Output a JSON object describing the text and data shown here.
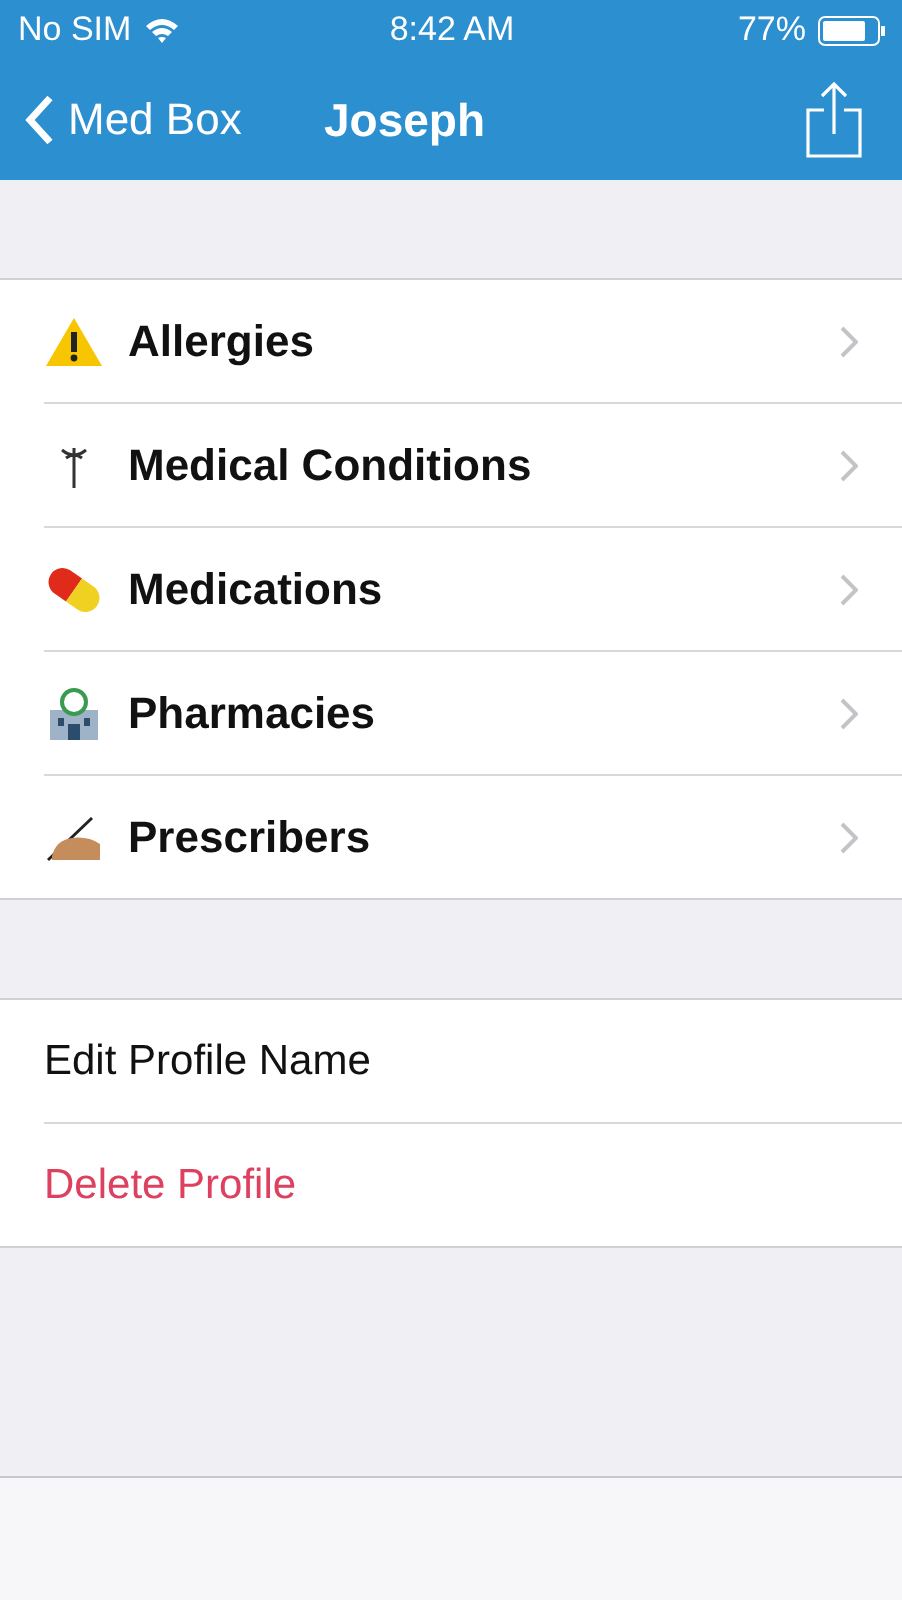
{
  "status_bar": {
    "carrier": "No SIM",
    "time": "8:42 AM",
    "battery": "77%"
  },
  "nav_bar": {
    "back_label": "Med Box",
    "title": "Joseph"
  },
  "menu_items": [
    {
      "label": "Allergies",
      "kind": "warning"
    },
    {
      "label": "Medical Conditions",
      "kind": "caduceus"
    },
    {
      "label": "Medications",
      "kind": "pill"
    },
    {
      "label": "Pharmacies",
      "kind": "building"
    },
    {
      "label": "Prescribers",
      "kind": "writing"
    }
  ],
  "actions": [
    {
      "label": "Edit Profile Name",
      "kind": "normal"
    },
    {
      "label": "Delete Profile",
      "kind": "destructive"
    }
  ]
}
